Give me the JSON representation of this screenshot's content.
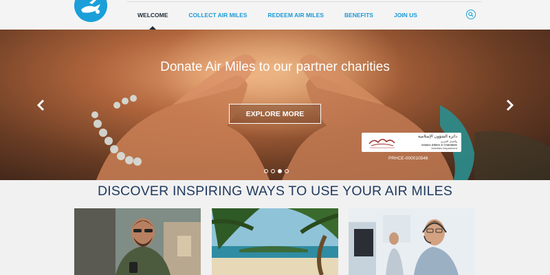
{
  "header": {
    "logo_icon": "airplane-globe-logo",
    "nav": [
      {
        "label": "WELCOME",
        "active": true
      },
      {
        "label": "COLLECT AIR MILES",
        "active": false
      },
      {
        "label": "REDEEM AIR MILES",
        "active": false
      },
      {
        "label": "BENEFITS",
        "active": false
      },
      {
        "label": "JOIN US",
        "active": false
      }
    ],
    "search_icon": "search-icon"
  },
  "hero": {
    "title": "Donate Air Miles to our partner charities",
    "cta_label": "EXPLORE MORE",
    "slides": {
      "count": 4,
      "active_index": 2
    },
    "permit": {
      "arabic_title": "دائرة الشؤون الإسلامية",
      "arabic_subtitle": "والعمل الخيري",
      "english_name": "Islamic Affairs & Charitable",
      "english_sub": "Activities Department",
      "code": "PRHCE-000010548"
    }
  },
  "discover": {
    "title": "DISCOVER INSPIRING WAYS TO USE YOUR AIR MILES",
    "cards": [
      {
        "image": "smiling-man-with-phone-photo"
      },
      {
        "image": "tropical-beach-palm-photo"
      },
      {
        "image": "call-center-agent-photo"
      }
    ]
  },
  "colors": {
    "accent": "#1a9ad6",
    "heading": "#1f3a5f",
    "nav_active": "#1d2a3a"
  }
}
